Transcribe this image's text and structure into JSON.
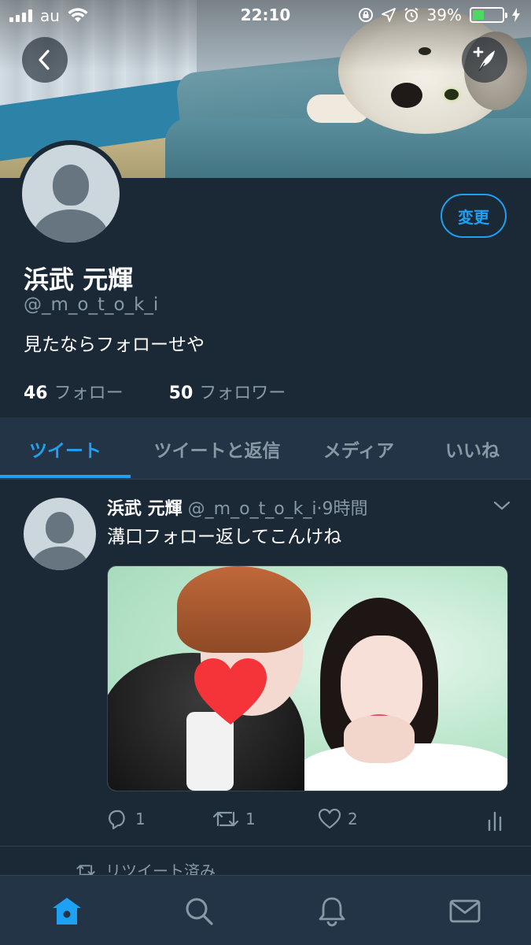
{
  "status_bar": {
    "carrier": "au",
    "time": "22:10",
    "battery_percent": "39%",
    "battery_level": 0.39
  },
  "profile": {
    "name": "浜武 元輝",
    "handle": "@_m_o_t_o_k_i",
    "bio": "見たならフォローせや",
    "edit_label": "変更",
    "following_count": "46",
    "following_label": "フォロー",
    "followers_count": "50",
    "followers_label": "フォロワー"
  },
  "tabs": [
    {
      "label": "ツイート",
      "active": true
    },
    {
      "label": "ツイートと返信",
      "active": false
    },
    {
      "label": "メディア",
      "active": false
    },
    {
      "label": "いいね",
      "active": false
    }
  ],
  "tweet": {
    "name": "浜武 元輝",
    "handle": "@_m_o_t_o_k_i",
    "dot": "·",
    "time": "9時間",
    "text": "溝口フォロー返してこんけね",
    "reply_count": "1",
    "retweet_count": "1",
    "like_count": "2"
  },
  "next_item": {
    "retweeted_label": "リツイート済み"
  },
  "icons": {
    "back": "chevron-left-icon",
    "compose": "compose-feather-icon",
    "home": "home-icon",
    "search": "search-icon",
    "notifications": "bell-icon",
    "messages": "mail-icon"
  },
  "colors": {
    "background": "#1b2836",
    "tab_bar": "#243447",
    "accent": "#1da1f2",
    "secondary_text": "#8899a6",
    "battery_fill": "#4cd964",
    "heart_sticker": "#f5343a"
  }
}
